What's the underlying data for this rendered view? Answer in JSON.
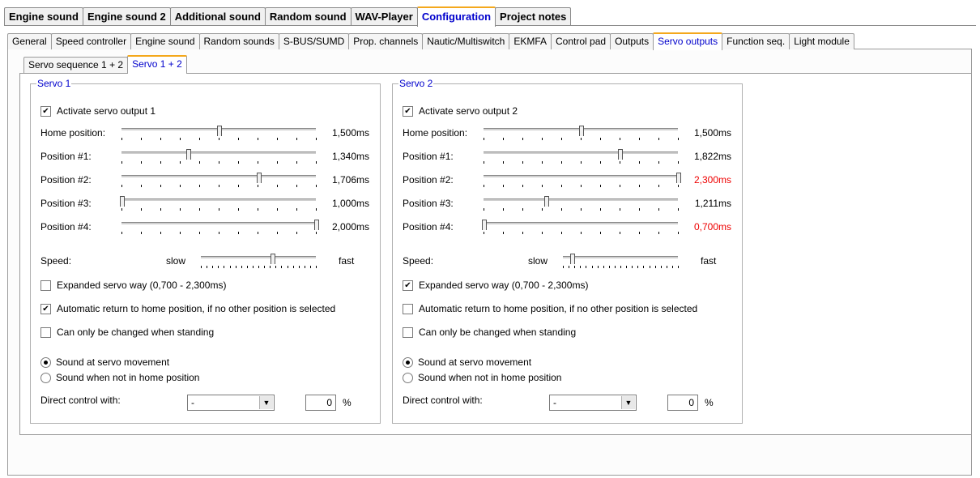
{
  "main_tabs": [
    "Engine sound",
    "Engine sound 2",
    "Additional sound",
    "Random sound",
    "WAV-Player",
    "Configuration",
    "Project notes"
  ],
  "main_active": 5,
  "sub_tabs": [
    "General",
    "Speed controller",
    "Engine sound",
    "Random sounds",
    "S-BUS/SUMD",
    "Prop. channels",
    "Nautic/Multiswitch",
    "EKMFA",
    "Control pad",
    "Outputs",
    "Servo outputs",
    "Function seq.",
    "Light module"
  ],
  "sub_active": 10,
  "inner_tabs": [
    "Servo sequence  1 + 2",
    "Servo 1 + 2"
  ],
  "inner_active": 1,
  "labels": {
    "home": "Home position:",
    "pos1": "Position #1:",
    "pos2": "Position #2:",
    "pos3": "Position #3:",
    "pos4": "Position #4:",
    "speed": "Speed:",
    "slow": "slow",
    "fast": "fast",
    "expanded": "Expanded servo way (0,700 - 2,300ms)",
    "auto_return": "Automatic return to home position, if no other position is selected",
    "standing": "Can only be changed when standing",
    "sound_move": "Sound at servo movement",
    "sound_not_home": "Sound when not in home position",
    "direct": "Direct control with:",
    "percent": "%"
  },
  "servo1": {
    "title": "Servo 1",
    "activate_label": "Activate servo output 1",
    "activate_checked": true,
    "home": "1,500ms",
    "pos1": "1,340ms",
    "pos2": "1,706ms",
    "pos3": "1,000ms",
    "pos4": "2,000ms",
    "slider_fractions": [
      0.5,
      0.34,
      0.706,
      0.0,
      1.0
    ],
    "speed_fraction": 0.62,
    "expanded_checked": false,
    "auto_return_checked": true,
    "standing_checked": false,
    "sound_move_selected": true,
    "direct_value": "-",
    "direct_percent": "0"
  },
  "servo2": {
    "title": "Servo 2",
    "activate_label": "Activate servo output 2",
    "activate_checked": true,
    "home": "1,500ms",
    "pos1": "1,822ms",
    "pos2": "2,300ms",
    "pos3": "1,211ms",
    "pos4": "0,700ms",
    "slider_fractions": [
      0.5,
      0.701,
      1.0,
      0.319,
      0.0
    ],
    "speed_fraction": 0.08,
    "expanded_checked": true,
    "auto_return_checked": false,
    "standing_checked": false,
    "sound_move_selected": true,
    "direct_value": "-",
    "direct_percent": "0"
  },
  "colors": {
    "active_tab_text": "#0000cc",
    "active_tab_accent": "#f4a81c",
    "warn_value": "#ee0000"
  }
}
